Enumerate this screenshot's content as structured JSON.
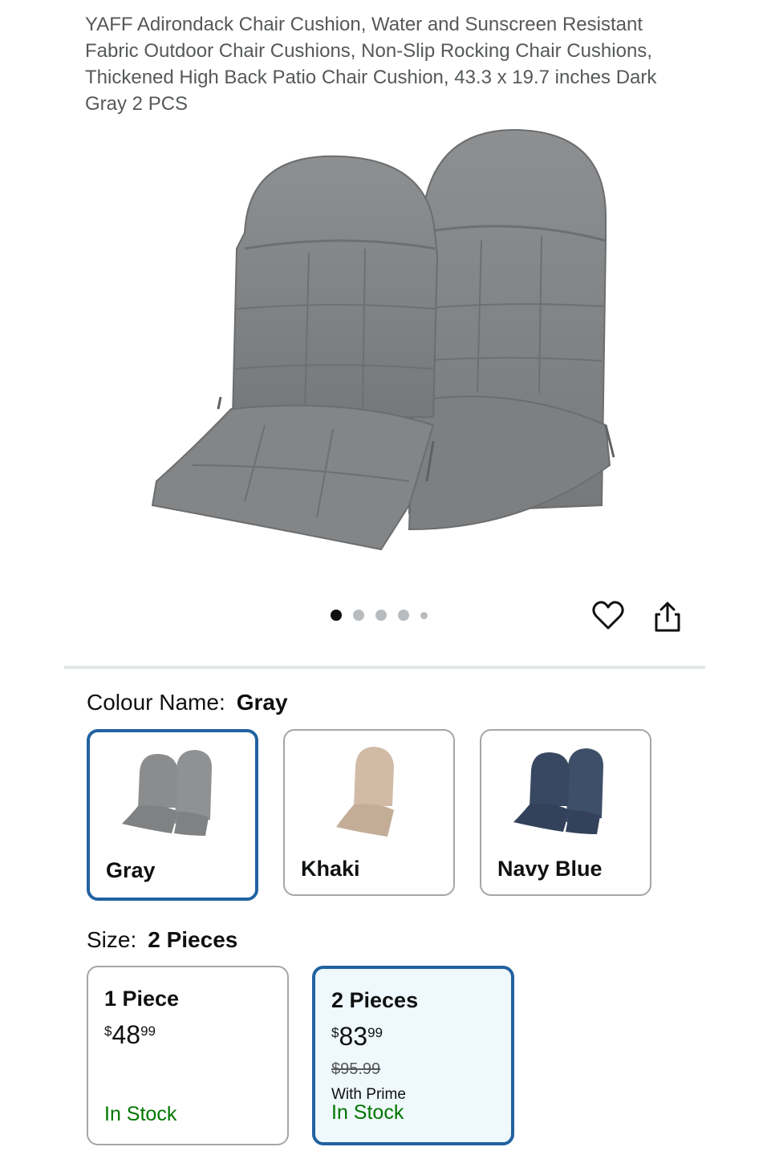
{
  "product": {
    "title": "YAFF Adirondack Chair Cushion, Water and Sunscreen Resistant Fabric Outdoor Chair Cushions, Non-Slip Rocking Chair Cushions, Thickened High Back Patio Chair Cushion, 43.3 x 19.7 inches Dark Gray 2 PCS"
  },
  "gallery": {
    "image_count": 5,
    "active_index": 0,
    "favorite_icon": "heart-icon",
    "share_icon": "share-icon"
  },
  "colour": {
    "label": "Colour Name:",
    "selected": "Gray",
    "options": [
      {
        "name": "Gray",
        "color": "#8a8c8e"
      },
      {
        "name": "Khaki",
        "color": "#cdb6a0"
      },
      {
        "name": "Navy Blue",
        "color": "#3a4a63"
      }
    ]
  },
  "size": {
    "label": "Size:",
    "selected": "2 Pieces",
    "options": [
      {
        "name": "1 Piece",
        "price_symbol": "$",
        "price_whole": "48",
        "price_fraction": "99",
        "stock": "In Stock"
      },
      {
        "name": "2 Pieces",
        "price_symbol": "$",
        "price_whole": "83",
        "price_fraction": "99",
        "list_price": "$95.99",
        "prime": "With Prime",
        "stock": "In Stock"
      }
    ]
  },
  "colors": {
    "selected_border": "#2162a1",
    "in_stock": "#007600",
    "selected_bg": "#eef8fd"
  }
}
